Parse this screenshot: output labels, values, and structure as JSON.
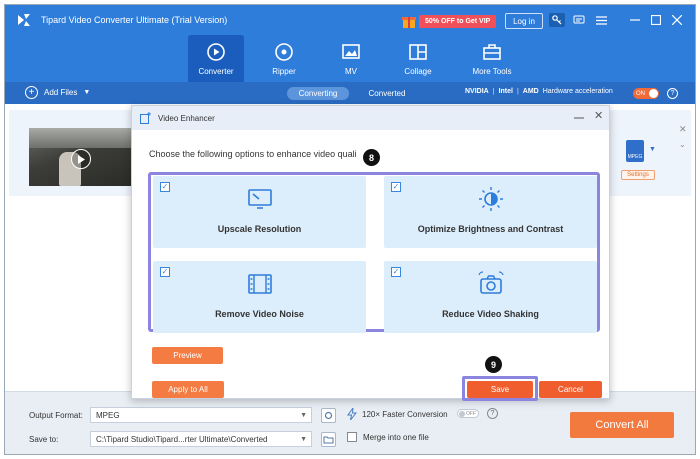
{
  "window": {
    "title": "Tipard Video Converter Ultimate (Trial Version)",
    "promo": "50% OFF to Get VIP",
    "login": "Log in"
  },
  "nav": {
    "tabs": [
      {
        "label": "Converter",
        "icon": "converter-icon",
        "active": true
      },
      {
        "label": "Ripper",
        "icon": "disc-icon"
      },
      {
        "label": "MV",
        "icon": "mv-icon"
      },
      {
        "label": "Collage",
        "icon": "collage-icon"
      },
      {
        "label": "More Tools",
        "icon": "toolbox-icon"
      }
    ]
  },
  "subbar": {
    "add_files": "Add Files",
    "tab_converting": "Converting",
    "tab_converted": "Converted",
    "nvidia": "NVIDIA",
    "intel": "Intel",
    "amd": "AMD",
    "hw_label": "Hardware acceleration",
    "hw_toggle": "ON",
    "help": "?"
  },
  "file": {
    "format_icon": "MPEG",
    "settings": "Settings"
  },
  "bottom": {
    "output_format_label": "Output Format:",
    "output_format_value": "MPEG",
    "save_to_label": "Save to:",
    "save_to_value": "C:\\Tipard Studio\\Tipard...rter Ultimate\\Converted",
    "faster_conversion": "120× Faster Conversion",
    "faster_toggle": "OFF",
    "merge": "Merge into one file",
    "convert_all": "Convert All",
    "help": "?"
  },
  "dialog": {
    "title": "Video Enhancer",
    "instruction": "Choose the following options to enhance video quali",
    "options": [
      {
        "label": "Upscale Resolution",
        "checked": true,
        "icon": "upscale-icon"
      },
      {
        "label": "Optimize Brightness and Contrast",
        "checked": true,
        "icon": "brightness-icon"
      },
      {
        "label": "Remove Video Noise",
        "checked": true,
        "icon": "film-noise-icon"
      },
      {
        "label": "Reduce Video Shaking",
        "checked": true,
        "icon": "camera-stabilize-icon"
      }
    ],
    "preview": "Preview",
    "apply_to_all": "Apply to All",
    "save": "Save",
    "cancel": "Cancel",
    "check_mark": "✓"
  },
  "steps": {
    "step_8": "8",
    "step_9": "9"
  },
  "colors": {
    "brand_blue": "#2f7ddb",
    "accent_orange": "#f37a3e",
    "highlight_purple": "#8c85e0"
  }
}
